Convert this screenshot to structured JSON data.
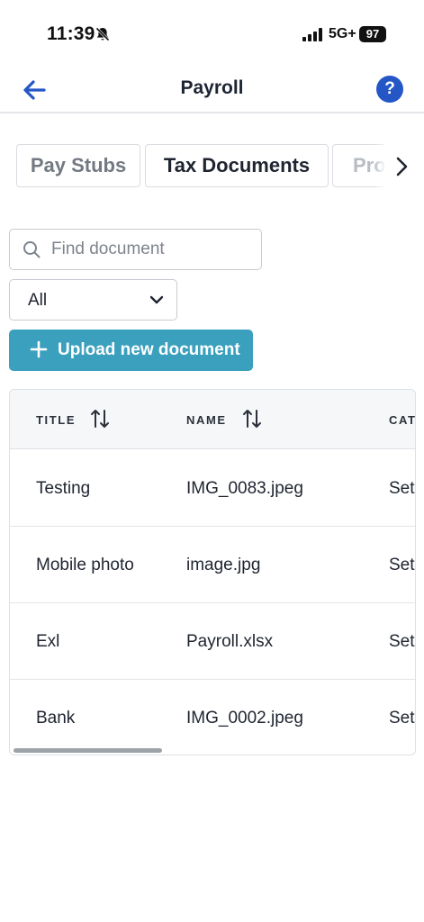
{
  "status_bar": {
    "time": "11:39",
    "network": "5G+",
    "battery": "97"
  },
  "header": {
    "title": "Payroll",
    "help_label": "?"
  },
  "tabs": [
    {
      "label": "Pay Stubs",
      "active": false
    },
    {
      "label": "Tax Documents",
      "active": true
    },
    {
      "label": "Pro",
      "active": false
    }
  ],
  "search": {
    "placeholder": "Find document",
    "value": ""
  },
  "filter": {
    "selected": "All"
  },
  "upload": {
    "label": "Upload new document"
  },
  "table": {
    "columns": [
      "TITLE",
      "NAME",
      "CAT"
    ],
    "rows": [
      {
        "title": "Testing",
        "name": "IMG_0083.jpeg",
        "category": "Set"
      },
      {
        "title": "Mobile photo",
        "name": "image.jpg",
        "category": "Set"
      },
      {
        "title": "Exl",
        "name": "Payroll.xlsx",
        "category": "Set"
      },
      {
        "title": "Bank",
        "name": "IMG_0002.jpeg",
        "category": "Set"
      }
    ]
  },
  "colors": {
    "accent": "#3aa0bd",
    "help": "#2457c5",
    "back_arrow": "#2457c5"
  }
}
